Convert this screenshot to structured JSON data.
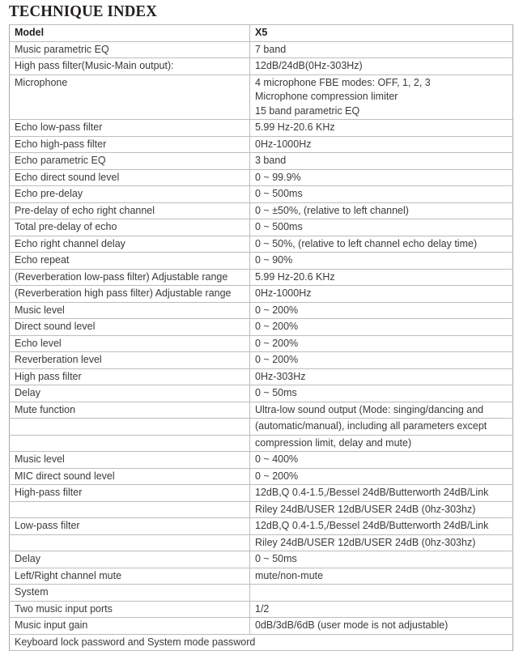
{
  "title": "TECHNIQUE INDEX",
  "table": {
    "columns": [
      "Model",
      "X5"
    ],
    "rows": [
      {
        "type": "header",
        "label": "Model",
        "value": "X5"
      },
      {
        "type": "normal",
        "label": "Music parametric EQ",
        "value": "7 band"
      },
      {
        "type": "normal",
        "label": "High pass filter(Music-Main output):",
        "value": "12dB/24dB(0Hz-303Hz)"
      },
      {
        "type": "multi",
        "label": "Microphone",
        "value": "4 microphone FBE modes: OFF, 1, 2, 3\nMicrophone compression limiter\n15 band parametric EQ",
        "lines": 3
      },
      {
        "type": "normal",
        "label": "Echo low-pass filter",
        "value": "5.99 Hz-20.6 KHz"
      },
      {
        "type": "normal",
        "label": "Echo high-pass filter",
        "value": "0Hz-1000Hz"
      },
      {
        "type": "normal",
        "label": "Echo parametric EQ",
        "value": "3 band"
      },
      {
        "type": "normal",
        "label": "Echo direct sound level",
        "value": "0 ~ 99.9%"
      },
      {
        "type": "normal",
        "label": "Echo pre-delay",
        "value": "0 ~ 500ms"
      },
      {
        "type": "normal",
        "label": "Pre-delay of echo right channel",
        "value": "0 ~ ±50%, (relative to left channel)"
      },
      {
        "type": "normal",
        "label": "Total pre-delay of echo",
        "value": "0 ~ 500ms"
      },
      {
        "type": "normal",
        "label": "Echo right channel delay",
        "value": "0 ~ 50%, (relative to left channel echo delay time)"
      },
      {
        "type": "normal",
        "label": "Echo repeat",
        "value": "0 ~ 90%"
      },
      {
        "type": "normal",
        "label": "(Reverberation low-pass filter) Adjustable range",
        "value": "5.99 Hz-20.6 KHz"
      },
      {
        "type": "normal",
        "label": "(Reverberation high pass filter) Adjustable range",
        "value": "0Hz-1000Hz"
      },
      {
        "type": "normal",
        "label": "Music level",
        "value": "0 ~ 200%"
      },
      {
        "type": "normal",
        "label": "Direct sound level",
        "value": "0 ~ 200%"
      },
      {
        "type": "normal",
        "label": "Echo level",
        "value": "0 ~ 200%"
      },
      {
        "type": "normal",
        "label": "Reverberation level",
        "value": "0 ~ 200%"
      },
      {
        "type": "normal",
        "label": "High pass filter",
        "value": "0Hz-303Hz"
      },
      {
        "type": "normal",
        "label": "Delay",
        "value": "0 ~ 50ms"
      },
      {
        "type": "normal",
        "label": "Mute function",
        "value": "Ultra-low sound output (Mode: singing/dancing and"
      },
      {
        "type": "normal",
        "label": "",
        "value": " (automatic/manual), including all parameters except"
      },
      {
        "type": "normal",
        "label": "",
        "value": "compression limit, delay and mute)"
      },
      {
        "type": "normal",
        "label": "Music level",
        "value": "0 ~ 400%"
      },
      {
        "type": "normal",
        "label": "MIC direct sound level",
        "value": "0 ~ 200%"
      },
      {
        "type": "normal",
        "label": "High-pass filter",
        "value": "12dB,Q 0.4-1.5,/Bessel 24dB/Butterworth 24dB/Link"
      },
      {
        "type": "normal",
        "label": "",
        "value": "Riley 24dB/USER 12dB/USER 24dB (0hz-303hz)"
      },
      {
        "type": "normal",
        "label": "Low-pass filter",
        "value": "12dB,Q 0.4-1.5,/Bessel 24dB/Butterworth 24dB/Link"
      },
      {
        "type": "normal",
        "label": "",
        "value": "Riley 24dB/USER 12dB/USER 24dB (0hz-303hz)"
      },
      {
        "type": "normal",
        "label": "Delay",
        "value": "0 ~ 50ms"
      },
      {
        "type": "normal",
        "label": "Left/Right channel mute",
        "value": "mute/non-mute"
      },
      {
        "type": "normal",
        "label": "System",
        "value": ""
      },
      {
        "type": "normal",
        "label": "Two music input ports",
        "value": "1/2"
      },
      {
        "type": "normal",
        "label": "Music input gain",
        "value": "0dB/3dB/6dB (user mode is not adjustable)"
      },
      {
        "type": "span",
        "label": "Keyboard lock password and System mode password",
        "value": ""
      }
    ]
  },
  "colors": {
    "text": "#3a3a3a",
    "heading": "#231f20",
    "border_inner": "#bdbdbd",
    "border_outer": "#a8a8a8",
    "background": "#ffffff"
  }
}
